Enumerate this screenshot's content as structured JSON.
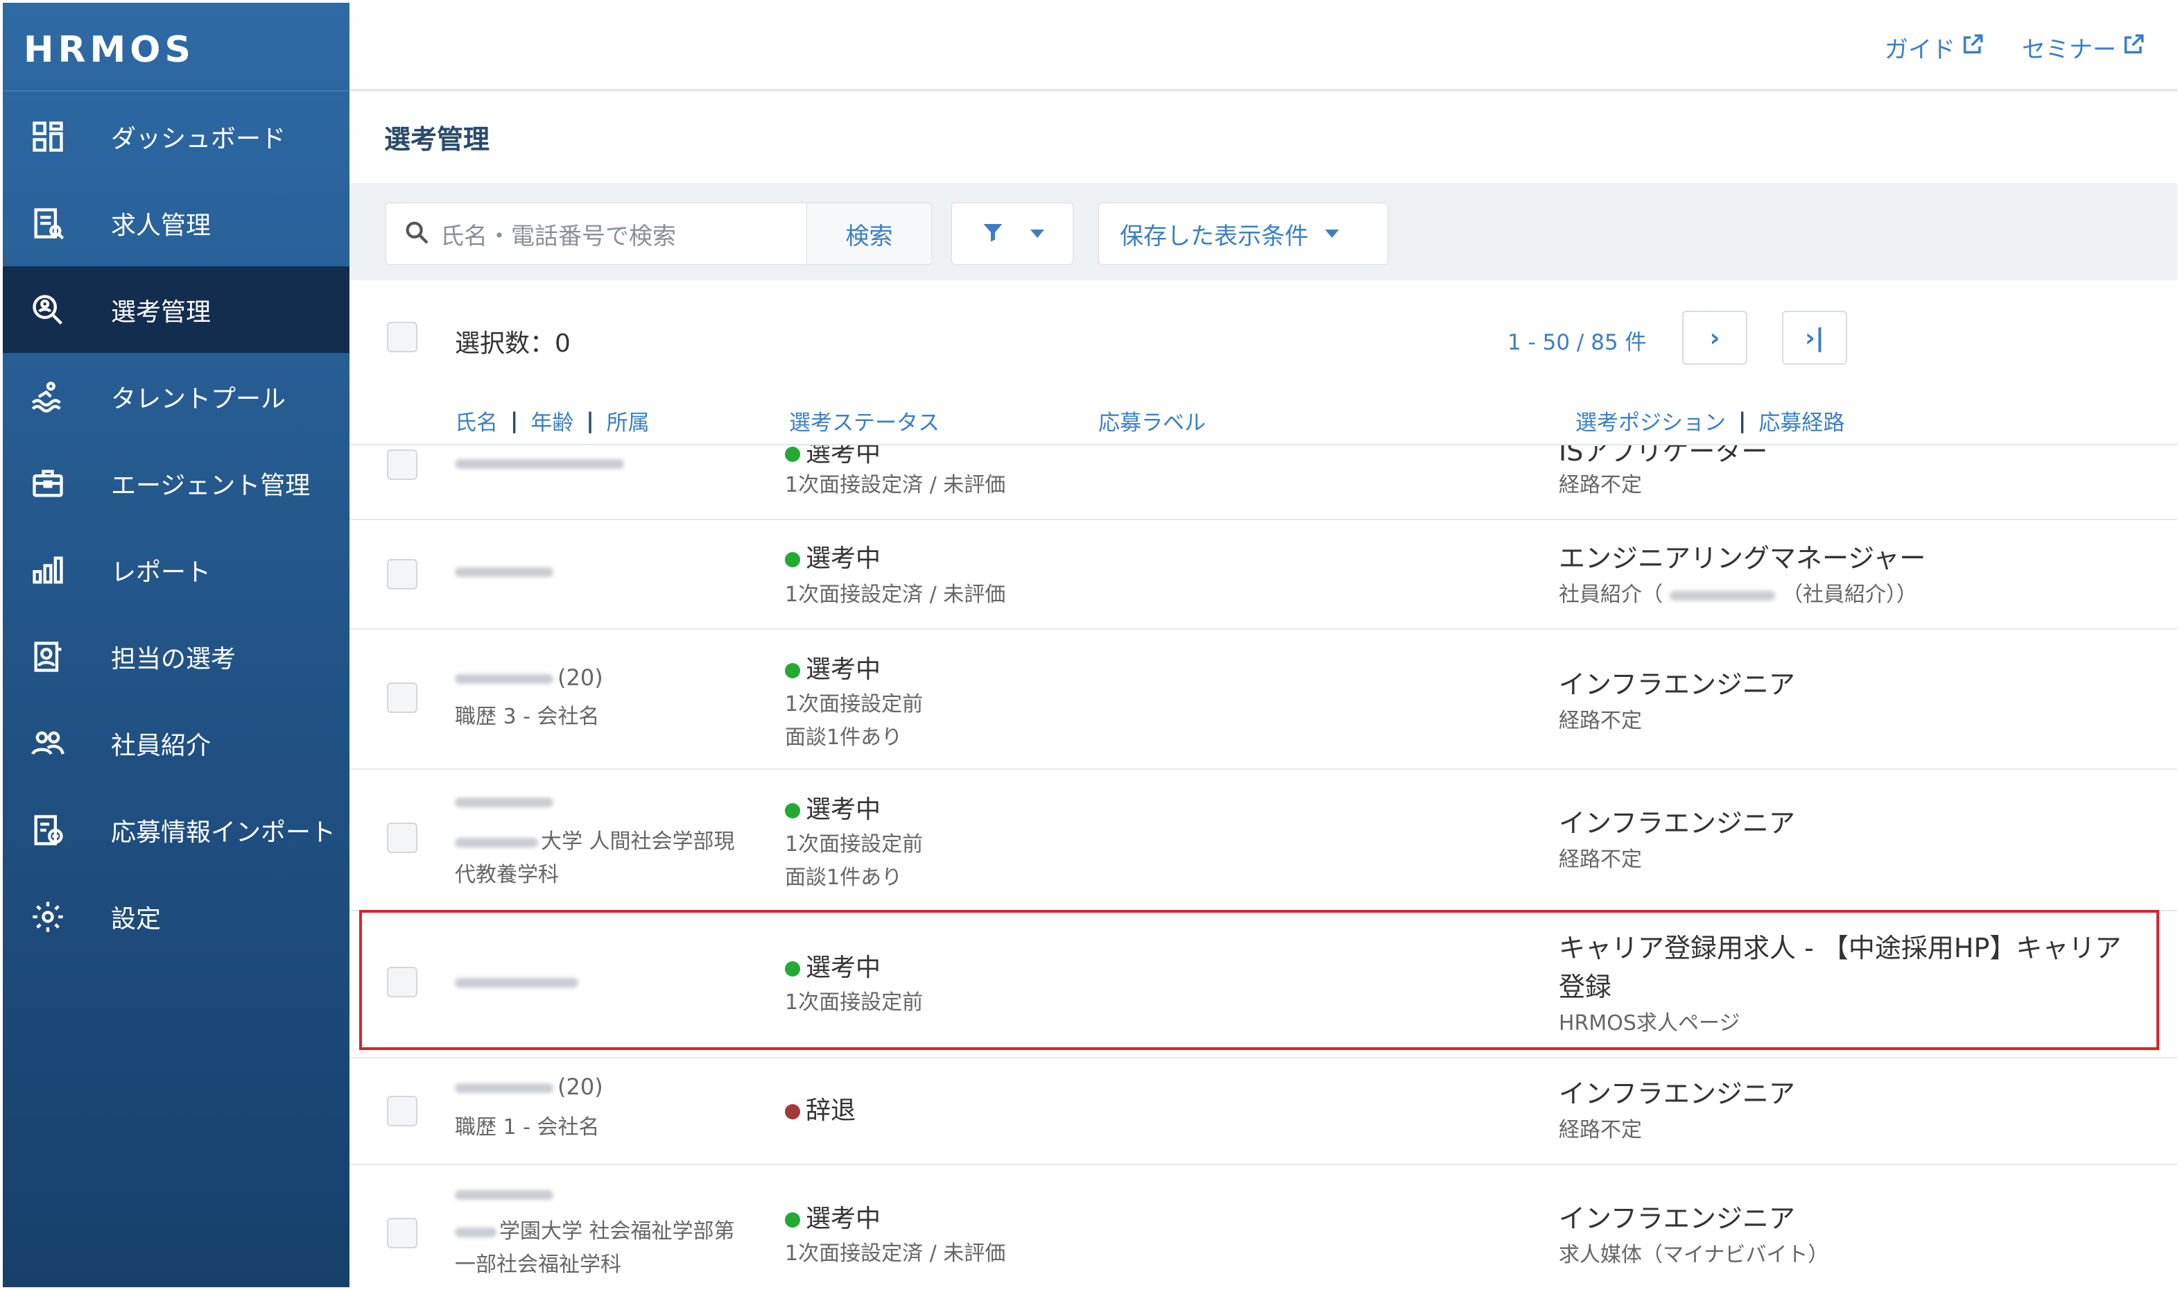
{
  "app": {
    "logo": "HRMOS"
  },
  "topbar": {
    "guide": "ガイド",
    "seminar": "セミナー"
  },
  "sidebar": {
    "items": [
      {
        "label": "ダッシュボード",
        "icon": "dashboard-icon"
      },
      {
        "label": "求人管理",
        "icon": "job-icon"
      },
      {
        "label": "選考管理",
        "icon": "search-person-icon",
        "active": true
      },
      {
        "label": "タレントプール",
        "icon": "pool-icon"
      },
      {
        "label": "エージェント管理",
        "icon": "briefcase-icon"
      },
      {
        "label": "レポート",
        "icon": "bar-chart-icon"
      },
      {
        "label": "担当の選考",
        "icon": "assigned-icon"
      },
      {
        "label": "社員紹介",
        "icon": "people-icon"
      },
      {
        "label": "応募情報インポート",
        "icon": "import-icon"
      },
      {
        "label": "設定",
        "icon": "gear-icon"
      }
    ]
  },
  "page": {
    "title": "選考管理"
  },
  "toolbar": {
    "search_placeholder": "氏名・電話番号で検索",
    "search_button": "検索",
    "saved_conditions": "保存した表示条件"
  },
  "selection": {
    "count_label": "選択数：0"
  },
  "pager": {
    "range": "1 - 50 / 85 件",
    "next": "›",
    "last": "›|"
  },
  "columns": {
    "name": "氏名",
    "age": "年齢",
    "affiliation": "所属",
    "status": "選考ステータス",
    "label": "応募ラベル",
    "position": "選考ポジション",
    "route": "応募経路"
  },
  "rows": [
    {
      "status": "選考中",
      "sub1": "1次面接設定済 / 未評価",
      "position": "ISアプリケーター",
      "route": "経路不定"
    },
    {
      "status": "選考中",
      "sub1": "1次面接設定済 / 未評価",
      "position": "エンジニアリングマネージャー",
      "route_a": "社員紹介（",
      "route_b": "（社員紹介））"
    },
    {
      "age": "(20)",
      "aff": "職歴 3 - 会社名",
      "status": "選考中",
      "sub1": "1次面接設定前",
      "sub2": "面談1件あり",
      "position": "インフラエンジニア",
      "route": "経路不定"
    },
    {
      "aff": "大学 人間社会学部現",
      "aff2": "代教養学科",
      "status": "選考中",
      "sub1": "1次面接設定前",
      "sub2": "面談1件あり",
      "position": "インフラエンジニア",
      "route": "経路不定"
    },
    {
      "status": "選考中",
      "sub1": "1次面接設定前",
      "position": "キャリア登録用求人 - 【中途採用HP】キャリア",
      "position2": "登録",
      "route": "HRMOS求人ページ"
    },
    {
      "age": "(20)",
      "aff": "職歴 1 - 会社名",
      "status": "辞退",
      "position": "インフラエンジニア",
      "route": "経路不定"
    },
    {
      "aff": "学園大学 社会福祉学部第",
      "aff2": "一部社会福祉学科",
      "status": "選考中",
      "sub1": "1次面接設定済 / 未評価",
      "position": "インフラエンジニア",
      "route": "求人媒体（マイナビバイト）"
    }
  ]
}
